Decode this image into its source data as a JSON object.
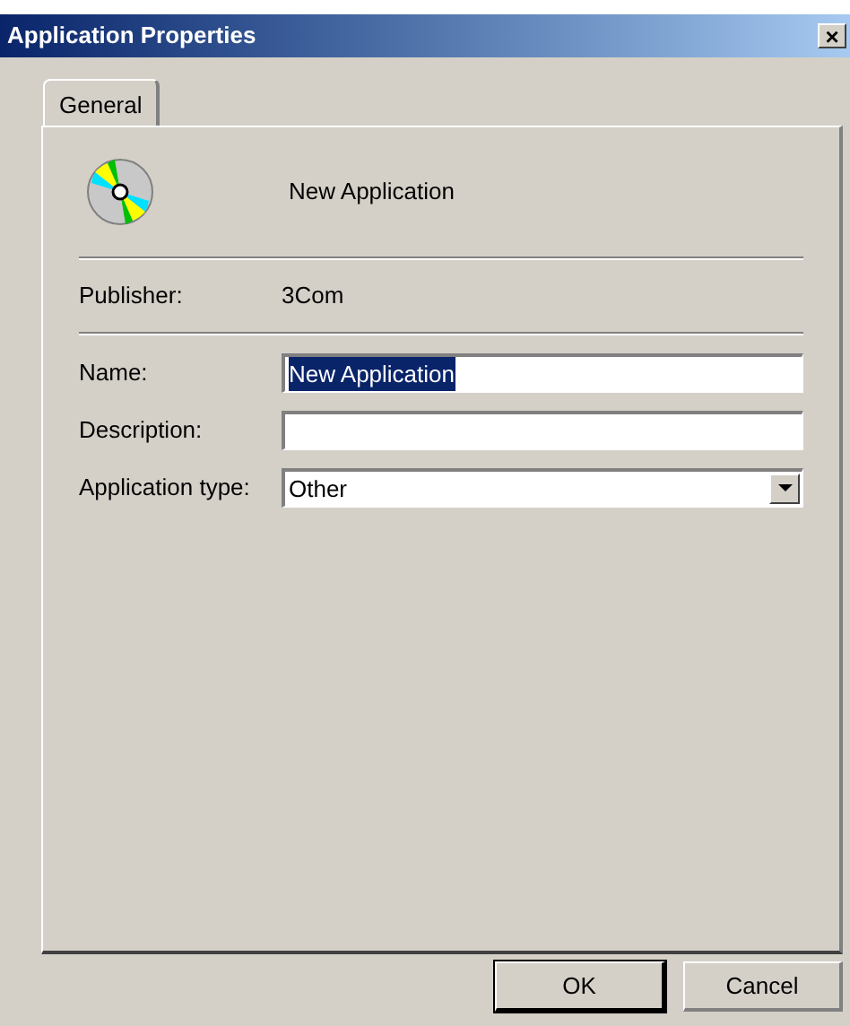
{
  "window": {
    "title": "Application Properties",
    "close": "×"
  },
  "tabs": [
    {
      "label": "General",
      "selected": true
    }
  ],
  "app_name": "New Application",
  "publisher": {
    "label": "Publisher:",
    "value": "3Com"
  },
  "fields": [
    {
      "kind": "text",
      "label": "Name:",
      "value": "New Application",
      "value_selected": true
    },
    {
      "kind": "text",
      "label": "Description:"
    },
    {
      "kind": "dropdown",
      "label": "Application type:",
      "value": "Other"
    }
  ],
  "buttons": [
    {
      "label": "OK",
      "default": true
    },
    {
      "label": "Cancel",
      "default": false
    }
  ]
}
